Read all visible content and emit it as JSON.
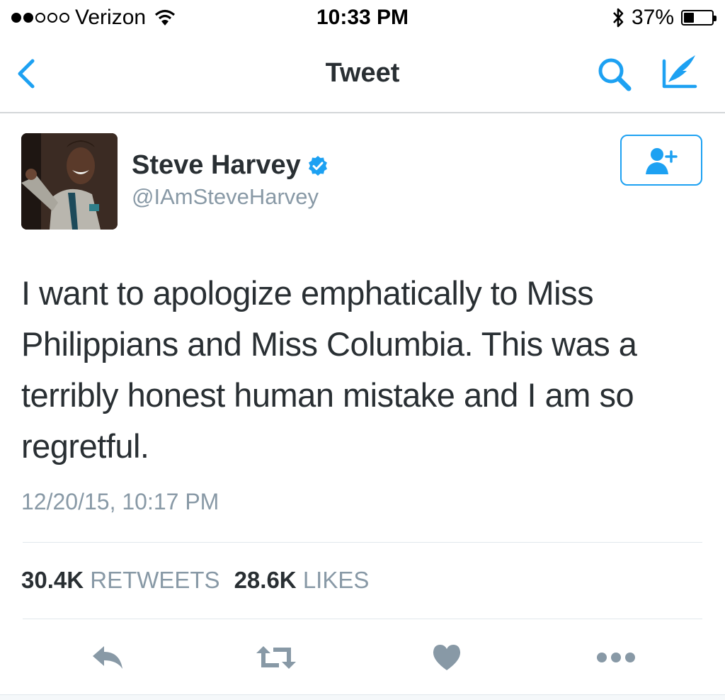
{
  "status_bar": {
    "carrier": "Verizon",
    "time": "10:33 PM",
    "battery": "37%",
    "battery_level": 0.37
  },
  "nav": {
    "title": "Tweet"
  },
  "tweet": {
    "author_name": "Steve Harvey",
    "author_handle": "@IAmSteveHarvey",
    "text": "I want to apologize emphatically to Miss Philippians and Miss Columbia. This was a terribly honest human mistake and I am so regretful.",
    "timestamp": "12/20/15, 10:17 PM",
    "retweets_count": "30.4K",
    "retweets_label": "RETWEETS",
    "likes_count": "28.6K",
    "likes_label": "LIKES"
  },
  "colors": {
    "accent": "#1da1f2",
    "icon_gray": "#8899a6",
    "text": "#292f33"
  },
  "icons": [
    "back-icon",
    "search-icon",
    "compose-icon",
    "verified-icon",
    "follow-icon",
    "reply-icon",
    "retweet-icon",
    "like-icon",
    "more-icon",
    "wifi-icon",
    "bluetooth-icon",
    "battery-icon"
  ]
}
